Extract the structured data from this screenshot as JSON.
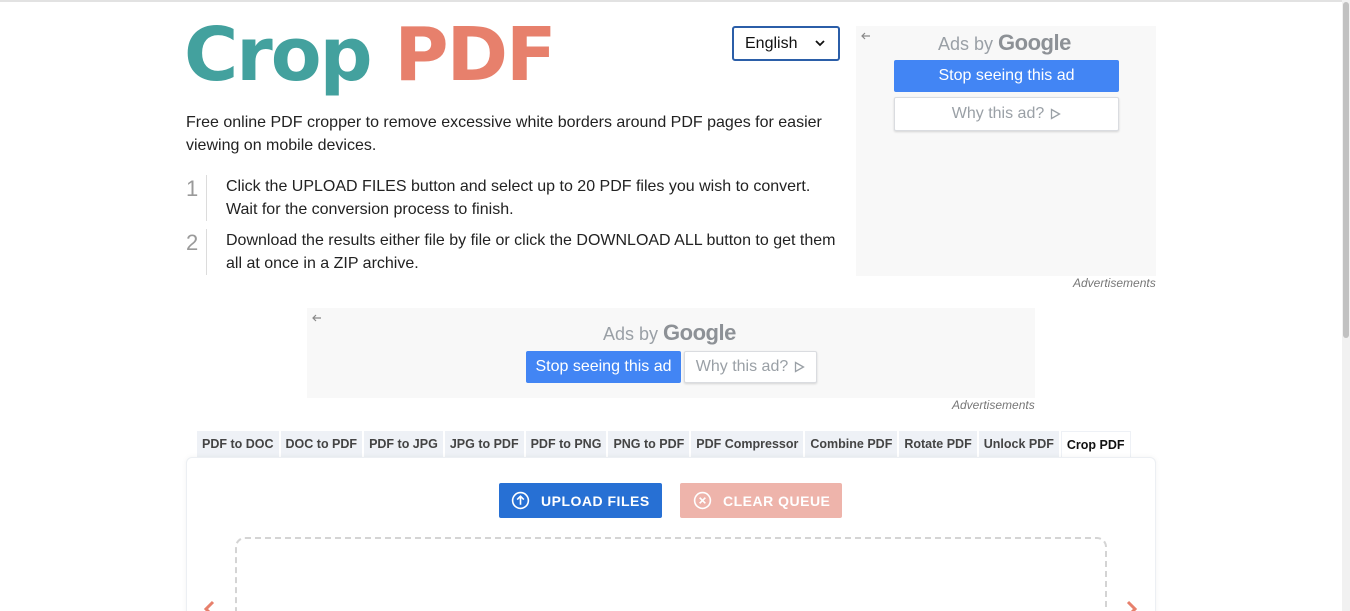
{
  "logo": {
    "word1": "Crop",
    "word2": "PDF"
  },
  "language": {
    "selected": "English"
  },
  "intro": "Free online PDF cropper to remove excessive white borders around PDF pages for easier viewing on mobile devices.",
  "steps": [
    {
      "num": "1",
      "text": "Click the UPLOAD FILES button and select up to 20 PDF files you wish to convert. Wait for the conversion process to finish."
    },
    {
      "num": "2",
      "text": "Download the results either file by file or click the DOWNLOAD ALL button to get them all at once in a ZIP archive."
    }
  ],
  "ad_side": {
    "ads_by": "Ads by",
    "brand": "Google",
    "stop": "Stop seeing this ad",
    "why": "Why this ad?",
    "label": "Advertisements"
  },
  "ad_mid": {
    "ads_by": "Ads by",
    "brand": "Google",
    "stop": "Stop seeing this ad",
    "why": "Why this ad?",
    "label": "Advertisements"
  },
  "tabs": [
    "PDF to DOC",
    "DOC to PDF",
    "PDF to JPG",
    "JPG to PDF",
    "PDF to PNG",
    "PNG to PDF",
    "PDF Compressor",
    "Combine PDF",
    "Rotate PDF",
    "Unlock PDF",
    "Crop PDF"
  ],
  "active_tab": "Crop PDF",
  "actions": {
    "upload": "UPLOAD FILES",
    "clear": "CLEAR QUEUE"
  },
  "colors": {
    "logo_teal": "#43a19e",
    "logo_coral": "#e7806c",
    "primary": "#2770d4",
    "clear_disabled": "#eeb4ab",
    "google_blue": "#4285f4"
  }
}
